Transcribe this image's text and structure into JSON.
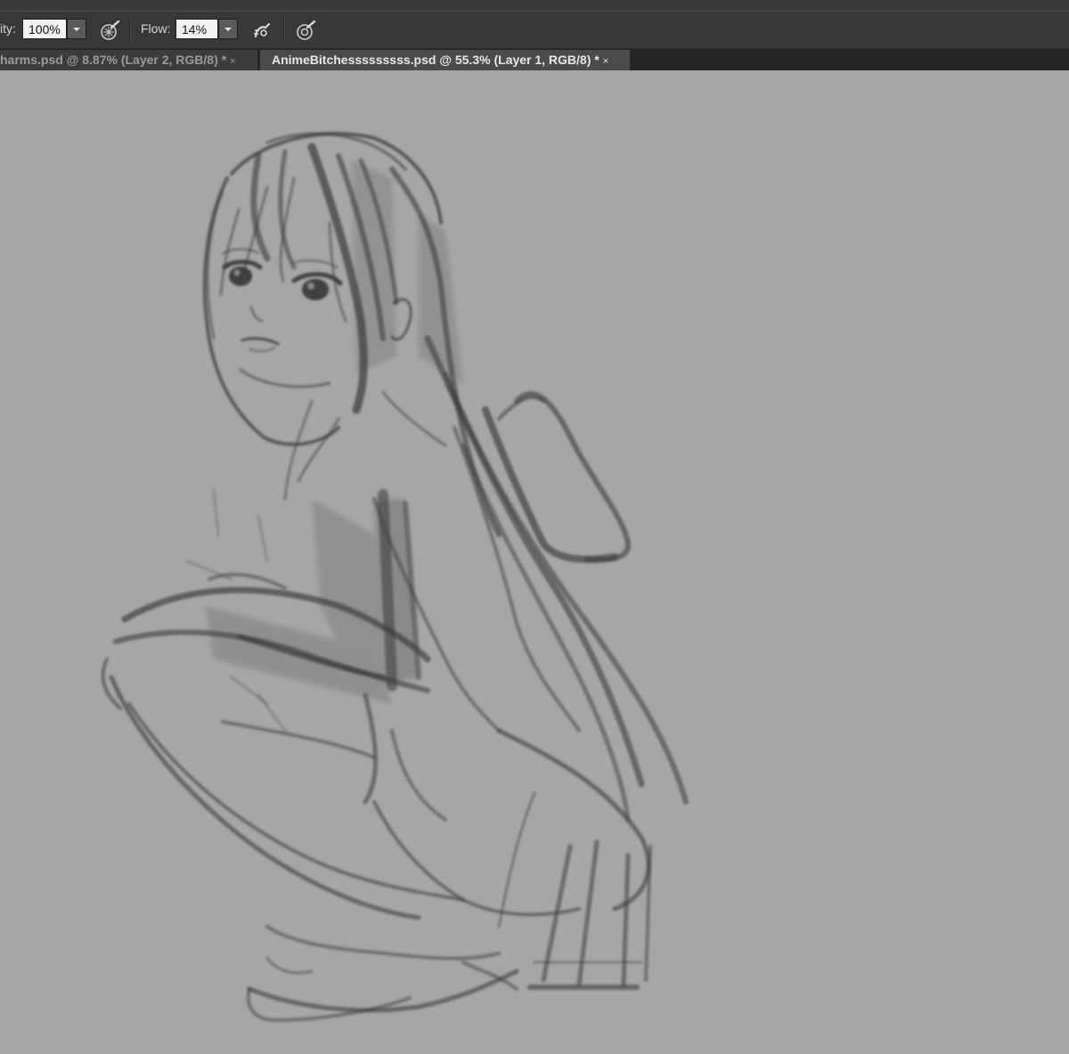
{
  "options_bar": {
    "opacity_label": "ity:",
    "opacity_value": "100%",
    "flow_label": "Flow:",
    "flow_value": "14%",
    "icons": [
      "pressure-opacity-icon",
      "airbrush-icon",
      "pressure-size-icon"
    ]
  },
  "tabs": [
    {
      "label": "harms.psd @ 8.87% (Layer 2, RGB/8) *",
      "close": "×",
      "active": false
    },
    {
      "label": "AnimeBitchesssssssss.psd @ 55.3% (Layer 1, RGB/8) *",
      "close": "×",
      "active": true
    }
  ],
  "canvas": {
    "background_color": "#a6a6a6",
    "artwork": "pencil sketch of crouching figure"
  },
  "colors": {
    "toolbar_bg": "#383838",
    "tab_active_bg": "#4b4b4b",
    "tab_inactive_bg": "#3c3c3c",
    "stroke": "#3c3c3c"
  }
}
